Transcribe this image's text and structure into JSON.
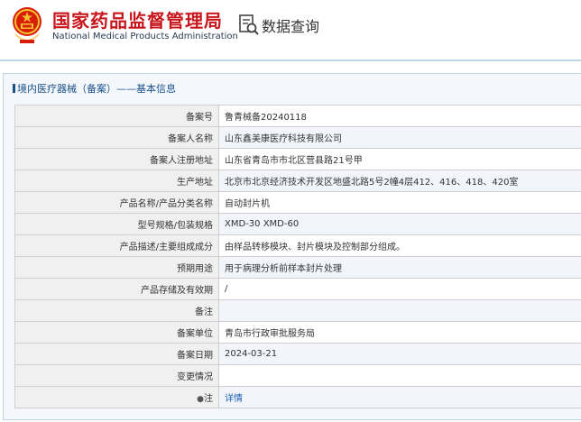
{
  "site": {
    "name_cn": "国家药品监督管理局",
    "name_en": "National Medical Products Administration"
  },
  "page": {
    "title": "数据查询"
  },
  "section": {
    "title": "境内医疗器械（备案）——基本信息"
  },
  "rows": [
    {
      "label": "备案号",
      "value": "鲁青械备20240118"
    },
    {
      "label": "备案人名称",
      "value": "山东鑫美康医疗科技有限公司"
    },
    {
      "label": "备案人注册地址",
      "value": "山东省青岛市市北区营县路21号甲"
    },
    {
      "label": "生产地址",
      "value": "北京市北京经济技术开发区地盛北路5号2幢4层412、416、418、420室"
    },
    {
      "label": "产品名称/产品分类名称",
      "value": "自动封片机"
    },
    {
      "label": "型号规格/包装规格",
      "value": "XMD-30 XMD-60"
    },
    {
      "label": "产品描述/主要组成成分",
      "value": "由样品转移模块、封片模块及控制部分组成。"
    },
    {
      "label": "预期用途",
      "value": "用于病理分析前样本封片处理"
    },
    {
      "label": "产品存储及有效期",
      "value": "/"
    },
    {
      "label": "备注",
      "value": ""
    },
    {
      "label": "备案单位",
      "value": "青岛市行政审批服务局"
    },
    {
      "label": "备案日期",
      "value": "2024-03-21"
    },
    {
      "label": "变更情况",
      "value": ""
    },
    {
      "label": "注",
      "value": "详情"
    }
  ],
  "colors": {
    "brand_red": "#c8161d",
    "link_blue": "#1a5fb4",
    "panel_border": "#bfd5ea"
  },
  "icons": [
    "national-emblem-icon",
    "search-document-icon",
    "section-bar-icon",
    "info-bullet-icon"
  ]
}
